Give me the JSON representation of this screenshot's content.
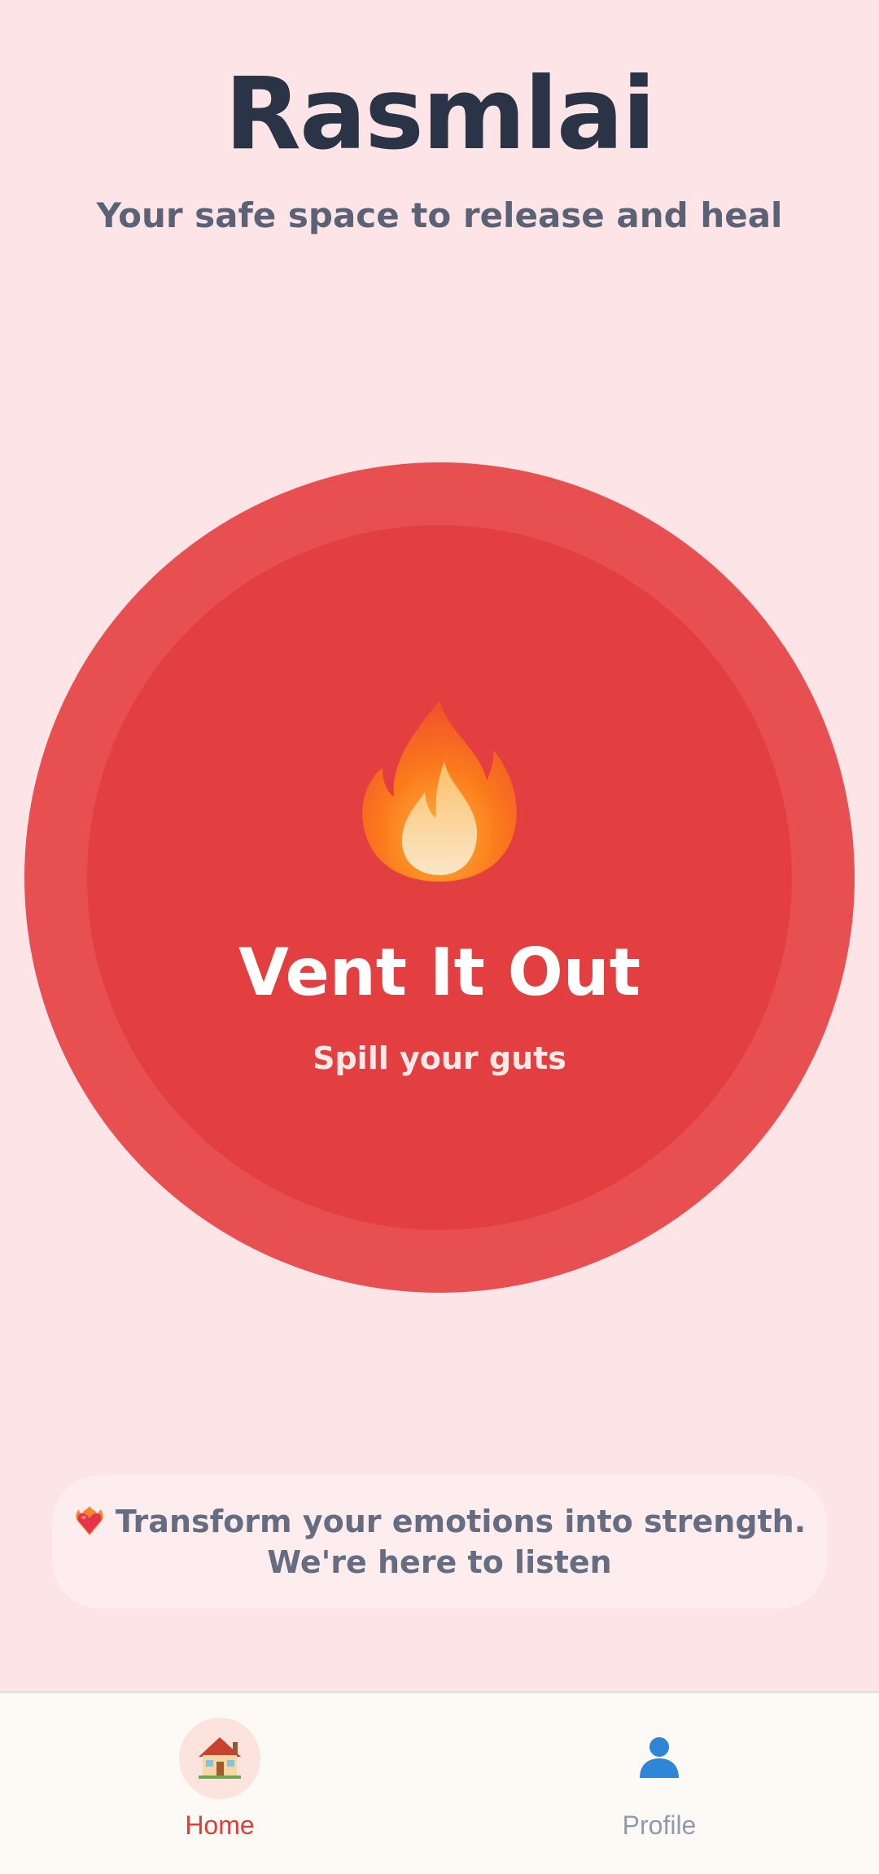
{
  "header": {
    "app_name": "Rasmlai",
    "tagline": "Your safe space to release and heal"
  },
  "vent_button": {
    "icon": "fire-icon",
    "title": "Vent It Out",
    "subtitle": "Spill your guts",
    "outer_color": "#e84f50",
    "inner_color": "#e43f40"
  },
  "message_card": {
    "icon": "heart-on-fire-icon",
    "line1": "Transform your emotions into strength.",
    "line2": "We're here to listen"
  },
  "bottom_nav": {
    "items": [
      {
        "label": "Home",
        "icon": "house-icon",
        "active": true
      },
      {
        "label": "Profile",
        "icon": "person-icon",
        "active": false
      }
    ]
  },
  "colors": {
    "background": "#fde5e7",
    "accent": "#e43f40",
    "nav_active": "#d9403c",
    "nav_inactive": "#8f9ab0"
  }
}
